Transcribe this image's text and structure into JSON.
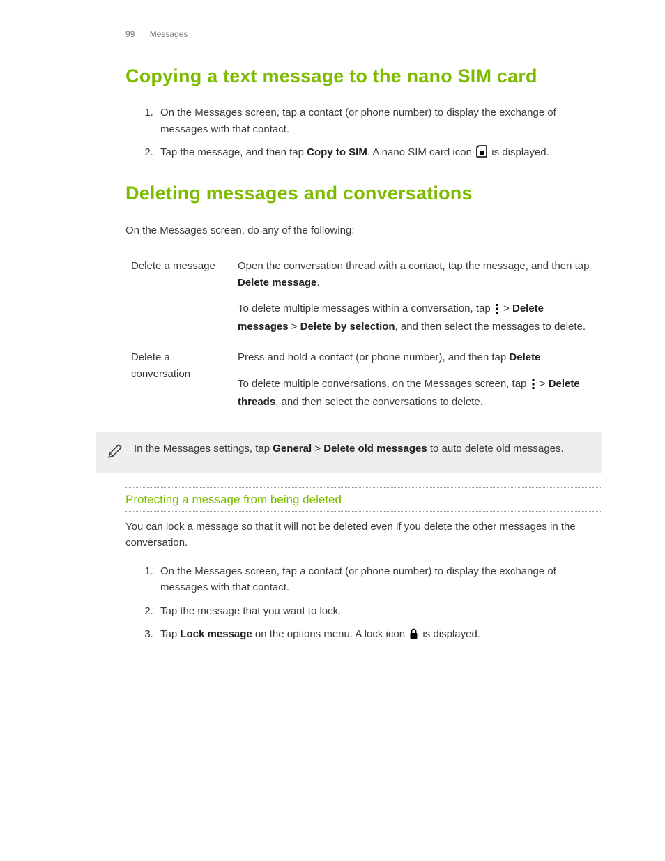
{
  "header": {
    "page": "99",
    "section": "Messages"
  },
  "s1": {
    "title": "Copying a text message to the nano SIM card",
    "steps": {
      "i1": "On the Messages screen, tap a contact (or phone number) to display the exchange of messages with that contact.",
      "i2a": "Tap the message, and then tap ",
      "i2_bold": "Copy to SIM",
      "i2b": ". A nano SIM card icon ",
      "i2c": " is displayed."
    }
  },
  "s2": {
    "title": "Deleting messages and conversations",
    "intro": "On the Messages screen, do any of the following:",
    "row1": {
      "key": "Delete a message",
      "p1a": "Open the conversation thread with a contact, tap the message, and then tap ",
      "p1_bold": "Delete message",
      "p1b": ".",
      "p2a": "To delete multiple messages within a conversation, tap ",
      "p2b": " > ",
      "p2_bold1": "Delete messages",
      "p2c": " > ",
      "p2_bold2": "Delete by selection",
      "p2d": ", and then select the messages to delete."
    },
    "row2": {
      "key": "Delete a conversation",
      "p1a": "Press and hold a contact (or phone number), and then tap ",
      "p1_bold": "Delete",
      "p1b": ".",
      "p2a": "To delete multiple conversations, on the Messages screen, tap ",
      "p2b": " > ",
      "p2_bold": "Delete threads",
      "p2c": ", and then select the conversations to delete."
    },
    "note": {
      "a": "In the Messages settings, tap ",
      "b1": "General",
      "m": " > ",
      "b2": "Delete old messages",
      "c": " to auto delete old messages."
    }
  },
  "s3": {
    "title": "Protecting a message from being deleted",
    "intro": "You can lock a message so that it will not be deleted even if you delete the other messages in the conversation.",
    "steps": {
      "i1": "On the Messages screen, tap a contact (or phone number) to display the exchange of messages with that contact.",
      "i2": "Tap the message that you want to lock.",
      "i3a": "Tap ",
      "i3_bold": "Lock message",
      "i3b": " on the options menu. A lock icon ",
      "i3c": " is displayed."
    }
  }
}
